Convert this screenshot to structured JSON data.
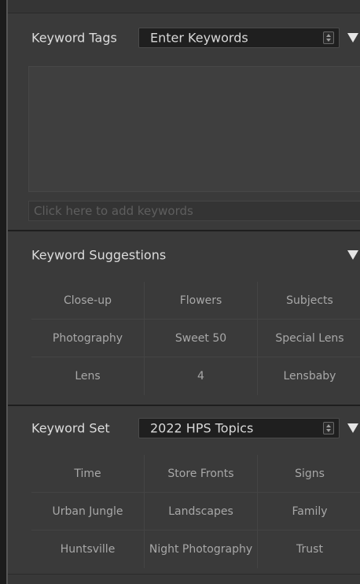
{
  "keyword_tags": {
    "label": "Keyword Tags",
    "dropdown_value": "Enter Keywords",
    "add_placeholder": "Click here to add keywords"
  },
  "keyword_suggestions": {
    "label": "Keyword Suggestions",
    "items": [
      "Close-up",
      "Flowers",
      "Subjects",
      "Photography",
      "Sweet 50",
      "Special Lens",
      "Lens",
      "4",
      "Lensbaby"
    ]
  },
  "keyword_set": {
    "label": "Keyword Set",
    "dropdown_value": "2022 HPS Topics",
    "items": [
      "Time",
      "Store Fronts",
      "Signs",
      "Urban Jungle",
      "Landscapes",
      "Family",
      "Huntsville",
      "Night Photography",
      "Trust"
    ]
  }
}
